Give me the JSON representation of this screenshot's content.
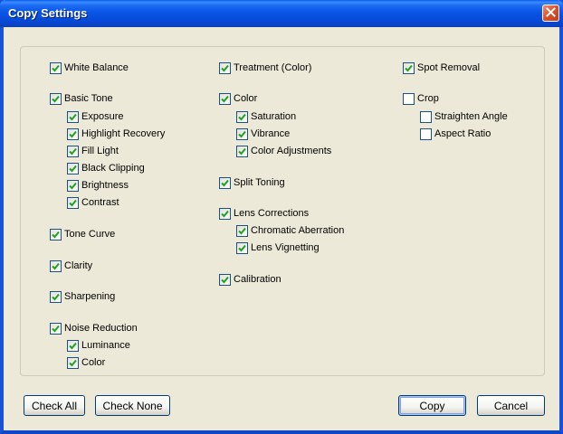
{
  "window": {
    "title": "Copy Settings"
  },
  "columns": [
    [
      {
        "label": "White Balance",
        "checked": true,
        "level": 0,
        "row": 0
      },
      {
        "label": "Basic Tone",
        "checked": true,
        "level": 0,
        "row": 1
      },
      {
        "label": "Exposure",
        "checked": true,
        "level": 1,
        "row": 2
      },
      {
        "label": "Highlight Recovery",
        "checked": true,
        "level": 1,
        "row": 3
      },
      {
        "label": "Fill Light",
        "checked": true,
        "level": 1,
        "row": 4
      },
      {
        "label": "Black Clipping",
        "checked": true,
        "level": 1,
        "row": 5
      },
      {
        "label": "Brightness",
        "checked": true,
        "level": 1,
        "row": 6
      },
      {
        "label": "Contrast",
        "checked": true,
        "level": 1,
        "row": 7
      },
      {
        "label": "Tone Curve",
        "checked": true,
        "level": 0,
        "row": 8
      },
      {
        "label": "Clarity",
        "checked": true,
        "level": 0,
        "row": 9
      },
      {
        "label": "Sharpening",
        "checked": true,
        "level": 0,
        "row": 10
      },
      {
        "label": "Noise Reduction",
        "checked": true,
        "level": 0,
        "row": 11
      },
      {
        "label": "Luminance",
        "checked": true,
        "level": 1,
        "row": 12
      },
      {
        "label": "Color",
        "checked": true,
        "level": 1,
        "row": 13
      }
    ],
    [
      {
        "label": "Treatment (Color)",
        "checked": true,
        "level": 0,
        "row": 0
      },
      {
        "label": "Color",
        "checked": true,
        "level": 0,
        "row": 1
      },
      {
        "label": "Saturation",
        "checked": true,
        "level": 1,
        "row": 2
      },
      {
        "label": "Vibrance",
        "checked": true,
        "level": 1,
        "row": 3
      },
      {
        "label": "Color Adjustments",
        "checked": true,
        "level": 1,
        "row": 4
      },
      {
        "label": "Split Toning",
        "checked": true,
        "level": 0,
        "row": 5
      },
      {
        "label": "Lens Corrections",
        "checked": true,
        "level": 0,
        "row": 6
      },
      {
        "label": "Chromatic Aberration",
        "checked": true,
        "level": 1,
        "row": 7
      },
      {
        "label": "Lens Vignetting",
        "checked": true,
        "level": 1,
        "row": 8
      },
      {
        "label": "Calibration",
        "checked": true,
        "level": 0,
        "row": 9
      }
    ],
    [
      {
        "label": "Spot Removal",
        "checked": true,
        "level": 0,
        "row": 0
      },
      {
        "label": "Crop",
        "checked": false,
        "level": 0,
        "row": 1
      },
      {
        "label": "Straighten Angle",
        "checked": false,
        "level": 1,
        "row": 2
      },
      {
        "label": "Aspect Ratio",
        "checked": false,
        "level": 1,
        "row": 3
      }
    ]
  ],
  "buttons": {
    "check_all": "Check All",
    "check_none": "Check None",
    "copy": "Copy",
    "cancel": "Cancel"
  },
  "colors": {
    "titlebar": "#0a5cf0",
    "checkmark": "#21a121",
    "dialog_bg": "#ece9d8"
  },
  "icons": {
    "close": "close-icon",
    "check": "checkmark-icon"
  }
}
